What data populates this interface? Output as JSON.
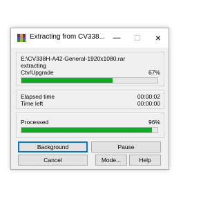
{
  "window": {
    "title": "Extracting from CV338...",
    "icon": "winrar-archive-icon",
    "controls": {
      "minimize": "—",
      "maximize": "☐",
      "close": "✕"
    }
  },
  "archive": {
    "path": "E:\\CV338H-A42-General-1920x1080.rar",
    "action": "extracting",
    "current_file": "Ctv/Upgrade",
    "file_percent_text": "67%",
    "file_progress": 0.67
  },
  "timing": {
    "elapsed_label": "Elapsed time",
    "elapsed_value": "00:00:02",
    "left_label": "Time left",
    "left_value": "00:00:00"
  },
  "processed": {
    "label": "Processed",
    "percent_text": "96%",
    "progress": 0.96
  },
  "buttons": {
    "background": "Background",
    "pause": "Pause",
    "cancel": "Cancel",
    "mode": "Mode...",
    "help": "Help"
  },
  "colors": {
    "progress": "#06b025",
    "focus": "#0078d7"
  }
}
